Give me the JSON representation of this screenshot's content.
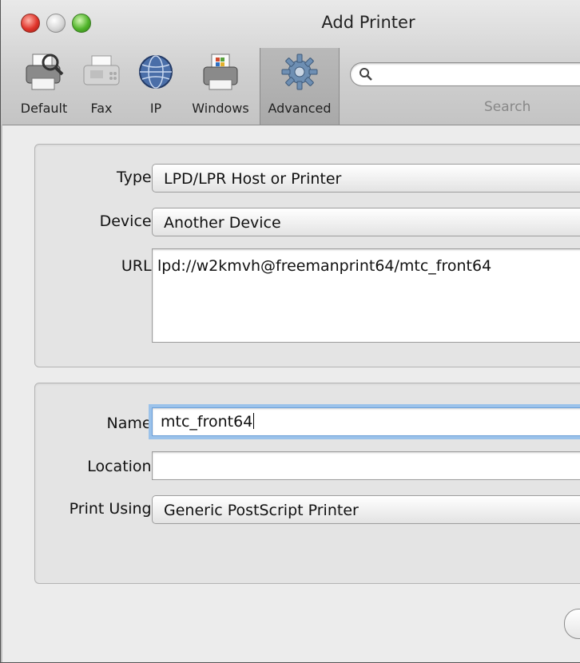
{
  "window": {
    "title": "Add Printer"
  },
  "toolbar": {
    "items": [
      {
        "label": "Default",
        "icon": "default-printer-icon"
      },
      {
        "label": "Fax",
        "icon": "fax-icon"
      },
      {
        "label": "IP",
        "icon": "globe-icon"
      },
      {
        "label": "Windows",
        "icon": "windows-printer-icon"
      },
      {
        "label": "Advanced",
        "icon": "gear-icon",
        "selected": true
      }
    ],
    "search": {
      "label": "Search",
      "value": "",
      "placeholder": ""
    }
  },
  "connection": {
    "type_label": "Type:",
    "type_value": "LPD/LPR Host or Printer",
    "device_label": "Device:",
    "device_value": "Another Device",
    "url_label": "URL:",
    "url_value": "lpd://w2kmvh@freemanprint64/mtc_front64"
  },
  "details": {
    "name_label": "Name:",
    "name_value": "mtc_front64",
    "location_label": "Location:",
    "location_value": "",
    "print_using_label": "Print Using:",
    "print_using_value": "Generic PostScript Printer"
  },
  "colors": {
    "focus_ring": "#9bc2ea",
    "selected_tool": "#ababab"
  }
}
